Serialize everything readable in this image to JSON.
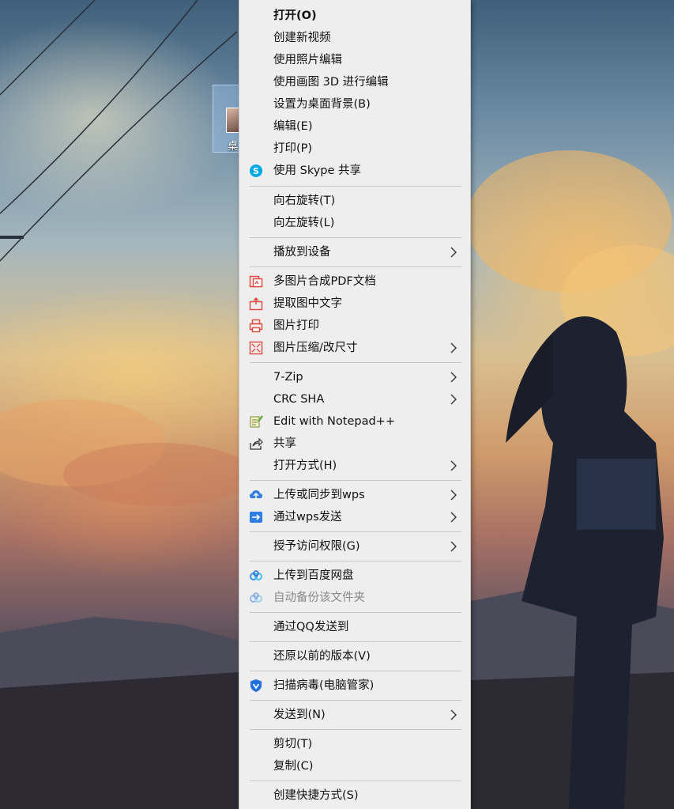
{
  "desktop": {
    "icon_label": "桌"
  },
  "menu": {
    "items": [
      {
        "label": "打开(O)"
      },
      {
        "label": "创建新视频"
      },
      {
        "label": "使用照片编辑"
      },
      {
        "label": "使用画图 3D 进行编辑"
      },
      {
        "label": "设置为桌面背景(B)"
      },
      {
        "label": "编辑(E)"
      },
      {
        "label": "打印(P)"
      },
      {
        "label": "使用 Skype 共享",
        "icon": "skype-icon"
      },
      {
        "label": "向右旋转(T)"
      },
      {
        "label": "向左旋转(L)"
      },
      {
        "label": "播放到设备",
        "submenu": true
      },
      {
        "label": "多图片合成PDF文档",
        "icon": "pdf-merge-icon"
      },
      {
        "label": "提取图中文字",
        "icon": "text-extract-icon"
      },
      {
        "label": "图片打印",
        "icon": "image-print-icon"
      },
      {
        "label": "图片压缩/改尺寸",
        "icon": "image-compress-icon",
        "submenu": true
      },
      {
        "label": "7-Zip",
        "submenu": true
      },
      {
        "label": "CRC SHA",
        "submenu": true
      },
      {
        "label": "Edit with Notepad++",
        "icon": "notepad-plus-icon"
      },
      {
        "label": "共享",
        "icon": "share-icon"
      },
      {
        "label": "打开方式(H)",
        "submenu": true
      },
      {
        "label": "上传或同步到wps",
        "icon": "wps-cloud-icon",
        "submenu": true
      },
      {
        "label": "通过wps发送",
        "icon": "wps-send-icon",
        "submenu": true
      },
      {
        "label": "授予访问权限(G)",
        "submenu": true
      },
      {
        "label": "上传到百度网盘",
        "icon": "baidu-netdisk-icon"
      },
      {
        "label": "自动备份该文件夹",
        "icon": "baidu-backup-icon",
        "disabled": true
      },
      {
        "label": "通过QQ发送到"
      },
      {
        "label": "还原以前的版本(V)"
      },
      {
        "label": "扫描病毒(电脑管家)",
        "icon": "pc-manager-shield-icon"
      },
      {
        "label": "发送到(N)",
        "submenu": true
      },
      {
        "label": "剪切(T)"
      },
      {
        "label": "复制(C)"
      },
      {
        "label": "创建快捷方式(S)"
      }
    ]
  },
  "colors": {
    "menu_bg": "#eeeeee",
    "separator": "#c4c4c4",
    "skype_blue": "#00a8e8",
    "tool_red": "#e4453a",
    "wps_blue": "#2f7de1",
    "baidu_blue": "#3a8ff0",
    "shield_blue": "#1f6fe0"
  }
}
